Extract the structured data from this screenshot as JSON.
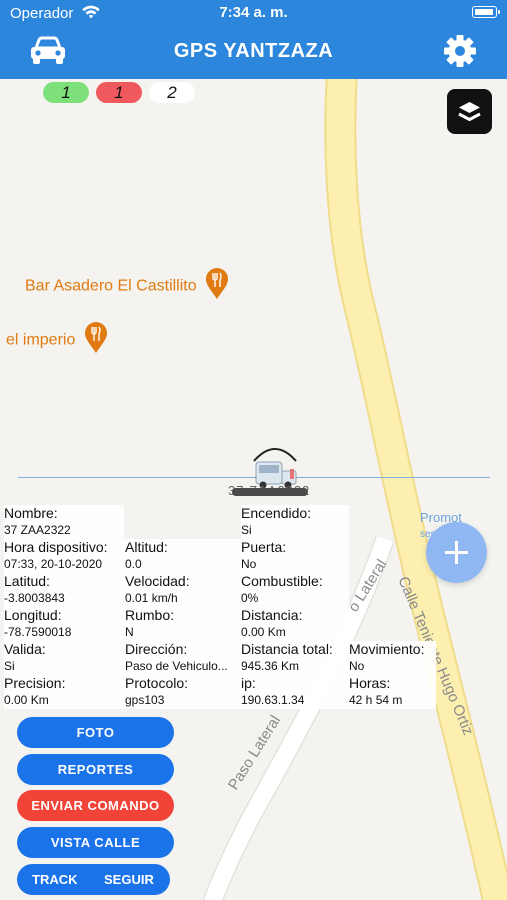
{
  "status_bar": {
    "carrier": "Operador",
    "time": "7:34 a. m."
  },
  "nav": {
    "title": "GPS YANTZAZA"
  },
  "counters": {
    "green": "1",
    "red": "1",
    "plain": "2"
  },
  "map": {
    "pois": [
      {
        "name": "Bar Asadero El Castillito"
      },
      {
        "name": "el imperio"
      }
    ],
    "streets": {
      "main": "Calle Teniente Hugo Ortiz",
      "lateral_1": "Paso Lateral",
      "lateral_2": "o Lateral"
    },
    "vehicle_label": "37 ZAA2322",
    "promo": "Promot",
    "promo_sub": "sesion"
  },
  "info": {
    "nombre": {
      "label": "Nombre:",
      "value": "37 ZAA2322"
    },
    "encendido": {
      "label": "Encendido:",
      "value": "Si"
    },
    "hora": {
      "label": "Hora dispositivo:",
      "value": "07:33, 20-10-2020"
    },
    "altitud": {
      "label": "Altitud:",
      "value": "0.0"
    },
    "puerta": {
      "label": "Puerta:",
      "value": "No"
    },
    "latitud": {
      "label": "Latitud:",
      "value": "-3.8003843"
    },
    "velocidad": {
      "label": "Velocidad:",
      "value": "0.01 km/h"
    },
    "combustible": {
      "label": "Combustible:",
      "value": "0%"
    },
    "longitud": {
      "label": "Longitud:",
      "value": "-78.7590018"
    },
    "rumbo": {
      "label": "Rumbo:",
      "value": "N"
    },
    "distancia": {
      "label": "Distancia:",
      "value": "0.00 Km"
    },
    "valida": {
      "label": "Valida:",
      "value": "Si"
    },
    "direccion": {
      "label": "Dirección:",
      "value": "Paso de Vehiculo..."
    },
    "distancia_total": {
      "label": "Distancia total:",
      "value": "945.36 Km"
    },
    "movimiento": {
      "label": "Movimiento:",
      "value": "No"
    },
    "precision": {
      "label": "Precision:",
      "value": "0.00 Km"
    },
    "protocolo": {
      "label": "Protocolo:",
      "value": "gps103"
    },
    "ip": {
      "label": "ip:",
      "value": "190.63.1.34"
    },
    "horas": {
      "label": "Horas:",
      "value": "42 h 54 m"
    }
  },
  "buttons": {
    "foto": "FOTO",
    "reportes": "REPORTES",
    "enviar_comando": "ENVIAR COMANDO",
    "vista_calle": "VISTA CALLE",
    "track": "TRACK",
    "seguir": "SEGUIR"
  },
  "colors": {
    "header": "#2b86dc",
    "button": "#1a73e8",
    "button_danger": "#f14337",
    "counter_green": "#7ee07a",
    "counter_red": "#f05a5e",
    "road_main": "#fcefaf",
    "poi": "#e07a12"
  },
  "icons": [
    "car-icon",
    "gear-icon",
    "wifi-icon",
    "battery-icon",
    "layers-icon",
    "restaurant-pin-icon",
    "vehicle-marker-icon",
    "plus-icon"
  ]
}
